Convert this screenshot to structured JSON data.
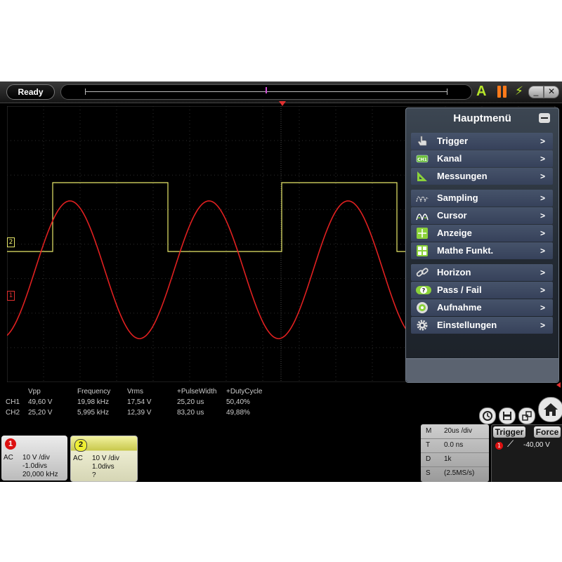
{
  "topbar": {
    "status": "Ready",
    "auto_label": "A"
  },
  "markers": {
    "ch1": "1",
    "ch2": "2"
  },
  "menu": {
    "title": "Hauptmenü",
    "groups": [
      [
        {
          "label": "Trigger",
          "icon": "hand-pointer-icon",
          "arrow": ">"
        },
        {
          "label": "Kanal",
          "icon": "ch1-badge-icon",
          "arrow": ">"
        },
        {
          "label": "Messungen",
          "icon": "ruler-triangle-icon",
          "arrow": ">"
        }
      ],
      [
        {
          "label": "Sampling",
          "icon": "sampling-wave-icon",
          "arrow": ">"
        },
        {
          "label": "Cursor",
          "icon": "cursor-wave-icon",
          "arrow": ">"
        },
        {
          "label": "Anzeige",
          "icon": "crosshair-display-icon",
          "arrow": ">"
        },
        {
          "label": "Mathe Funkt.",
          "icon": "calculator-icon",
          "arrow": ">"
        }
      ],
      [
        {
          "label": "Horizon",
          "icon": "link-chain-icon",
          "arrow": ">"
        },
        {
          "label": "Pass / Fail",
          "icon": "pass-fail-icon",
          "arrow": ">"
        },
        {
          "label": "Aufnahme",
          "icon": "record-icon",
          "arrow": ">"
        },
        {
          "label": "Einstellungen",
          "icon": "gear-icon",
          "arrow": ">"
        }
      ]
    ]
  },
  "measurements": {
    "headers": [
      "Vpp",
      "Frequency",
      "Vrms",
      "+PulseWidth",
      "+DutyCycle"
    ],
    "rows": [
      {
        "channel": "CH1",
        "values": [
          "49,60 V",
          "19,98 kHz",
          "17,54 V",
          "25,20 us",
          "50,40%"
        ]
      },
      {
        "channel": "CH2",
        "values": [
          "25,20 V",
          "5,995 kHz",
          "12,39 V",
          "83,20 us",
          "49,88%"
        ]
      }
    ]
  },
  "channels": {
    "ch1": {
      "badge": "1",
      "coupling": "AC",
      "lines": [
        "10 V /div",
        "-1.0divs",
        "20,000 kHz"
      ]
    },
    "ch2": {
      "badge": "2",
      "coupling": "AC",
      "lines": [
        "10 V /div",
        "1.0divs",
        "?"
      ]
    }
  },
  "horizontal": {
    "rows": [
      {
        "key": "M",
        "value": "20us /div"
      },
      {
        "key": "T",
        "value": "0.0 ns"
      },
      {
        "key": "D",
        "value": "1k"
      },
      {
        "key": "S",
        "value": "(2.5MS/s)"
      }
    ]
  },
  "trigger": {
    "trigger_label": "Trigger",
    "force_label": "Force",
    "source": "1",
    "level": "-40,00 V"
  },
  "colors": {
    "ch1": "#e02020",
    "ch2": "#e8e86a",
    "accent": "#b7e62a",
    "pause": "#ff7a1a"
  }
}
